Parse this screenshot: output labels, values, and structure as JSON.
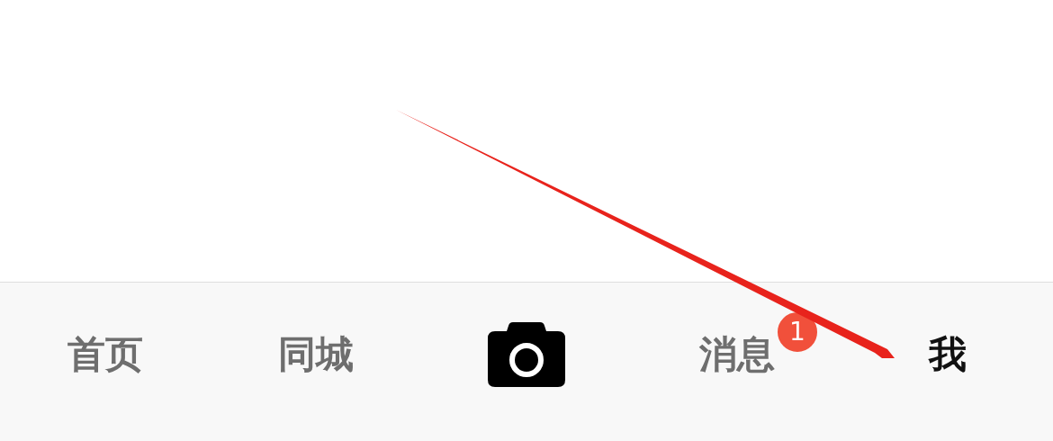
{
  "tab_bar": {
    "tabs": [
      {
        "kind": "text",
        "label": "首页",
        "selected": false
      },
      {
        "kind": "text",
        "label": "同城",
        "selected": false
      },
      {
        "kind": "camera",
        "selected": false
      },
      {
        "kind": "text",
        "label": "消息",
        "selected": false,
        "badge": "1"
      },
      {
        "kind": "text",
        "label": "我",
        "selected": true
      }
    ]
  },
  "annotation": {
    "kind": "arrow"
  }
}
